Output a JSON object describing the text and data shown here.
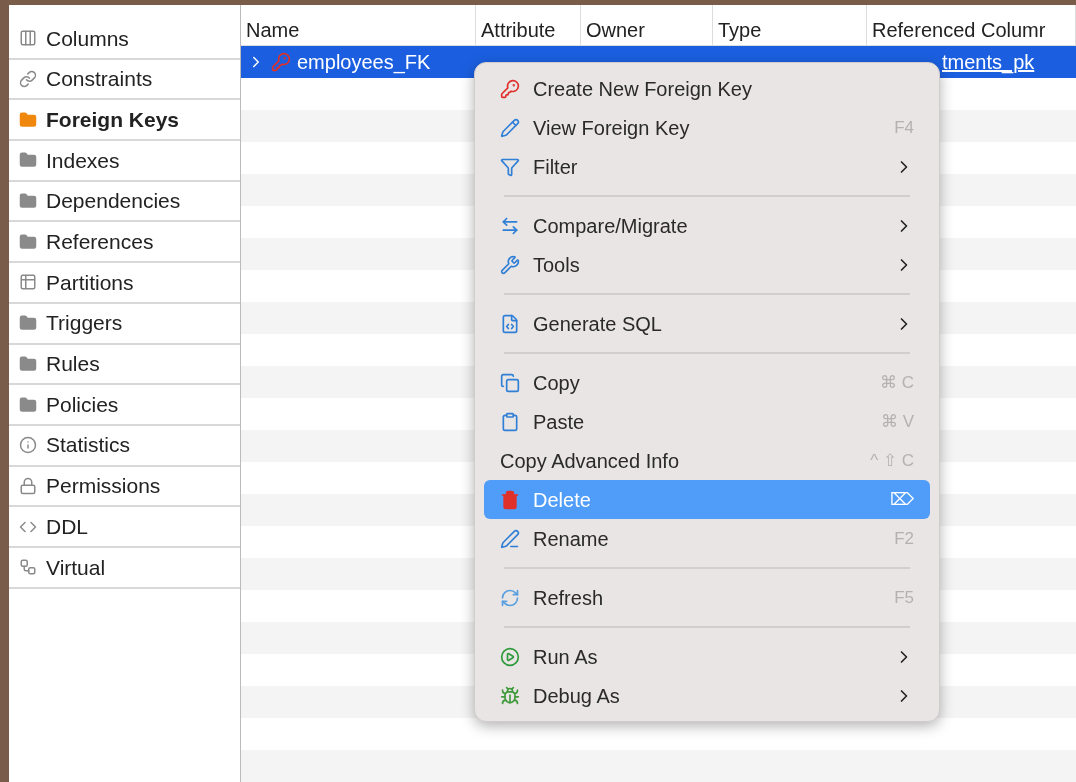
{
  "sidebar": {
    "items": [
      {
        "label": "Columns",
        "selected": false
      },
      {
        "label": "Constraints",
        "selected": false
      },
      {
        "label": "Foreign Keys",
        "selected": true
      },
      {
        "label": "Indexes",
        "selected": false
      },
      {
        "label": "Dependencies",
        "selected": false
      },
      {
        "label": "References",
        "selected": false
      },
      {
        "label": "Partitions",
        "selected": false
      },
      {
        "label": "Triggers",
        "selected": false
      },
      {
        "label": "Rules",
        "selected": false
      },
      {
        "label": "Policies",
        "selected": false
      },
      {
        "label": "Statistics",
        "selected": false
      },
      {
        "label": "Permissions",
        "selected": false
      },
      {
        "label": "DDL",
        "selected": false
      },
      {
        "label": "Virtual",
        "selected": false
      }
    ]
  },
  "table": {
    "columns": [
      "Name",
      "Attribute",
      "Owner",
      "Type",
      "Referenced Columr"
    ],
    "rows": [
      {
        "name": "employees_FK",
        "referenced_column": "tments_pk",
        "selected": true,
        "expanded": false
      }
    ]
  },
  "context_menu": {
    "items": [
      {
        "kind": "item",
        "label": "Create New Foreign Key",
        "submenu": false,
        "selected": false
      },
      {
        "kind": "item",
        "label": "View Foreign Key",
        "shortcut": "F4",
        "submenu": false,
        "selected": false
      },
      {
        "kind": "item",
        "label": "Filter",
        "submenu": true,
        "selected": false
      },
      {
        "kind": "separator"
      },
      {
        "kind": "item",
        "label": "Compare/Migrate",
        "submenu": true,
        "selected": false
      },
      {
        "kind": "item",
        "label": "Tools",
        "submenu": true,
        "selected": false
      },
      {
        "kind": "separator"
      },
      {
        "kind": "item",
        "label": "Generate SQL",
        "submenu": true,
        "selected": false
      },
      {
        "kind": "separator"
      },
      {
        "kind": "item",
        "label": "Copy",
        "shortcut": "⌘ C",
        "submenu": false,
        "selected": false
      },
      {
        "kind": "item",
        "label": "Paste",
        "shortcut": "⌘ V",
        "submenu": false,
        "selected": false
      },
      {
        "kind": "item",
        "label": "Copy Advanced Info",
        "shortcut": "^ ⇧ C",
        "submenu": false,
        "selected": false
      },
      {
        "kind": "item",
        "label": "Delete",
        "shortcut": "⌦",
        "submenu": false,
        "selected": true
      },
      {
        "kind": "item",
        "label": "Rename",
        "shortcut": "F2",
        "submenu": false,
        "selected": false
      },
      {
        "kind": "separator"
      },
      {
        "kind": "item",
        "label": "Refresh",
        "shortcut": "F5",
        "submenu": false,
        "selected": false
      },
      {
        "kind": "separator"
      },
      {
        "kind": "item",
        "label": "Run As",
        "submenu": true,
        "selected": false
      },
      {
        "kind": "item",
        "label": "Debug As",
        "submenu": true,
        "selected": false
      }
    ]
  }
}
